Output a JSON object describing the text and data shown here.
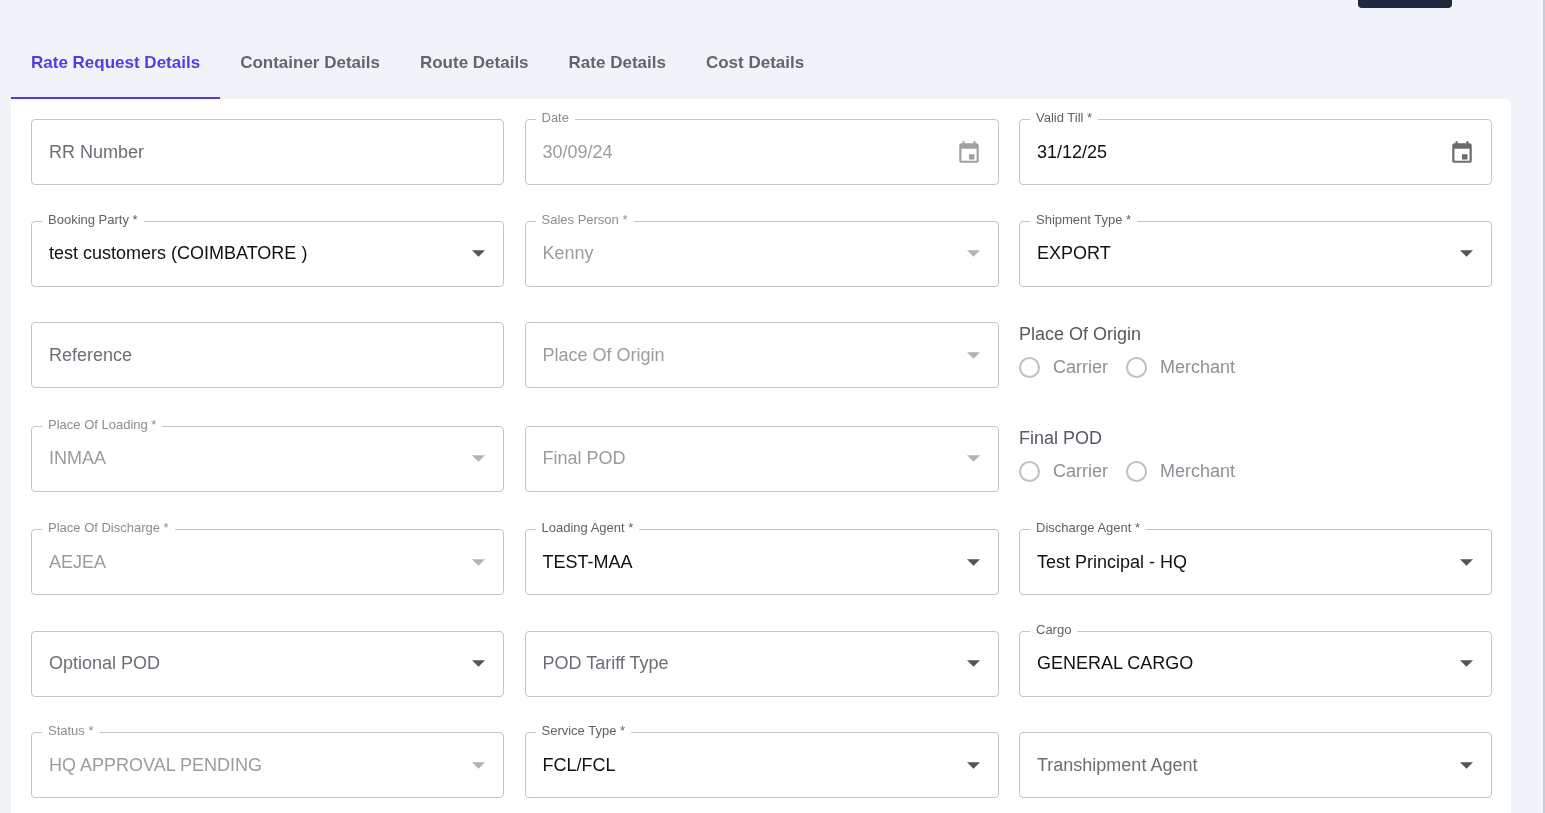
{
  "tabs": [
    {
      "label": "Rate Request Details",
      "selected": true
    },
    {
      "label": "Container Details",
      "selected": false
    },
    {
      "label": "Route Details",
      "selected": false
    },
    {
      "label": "Rate Details",
      "selected": false
    },
    {
      "label": "Cost Details",
      "selected": false
    }
  ],
  "fields": [
    {
      "kind": "text",
      "placeholder": "RR Number",
      "disabled": false
    },
    {
      "kind": "date",
      "label": "Date",
      "value": "30/09/24",
      "disabled": true
    },
    {
      "kind": "date",
      "label": "Valid Till *",
      "value": "31/12/25",
      "disabled": false
    },
    {
      "kind": "select",
      "label": "Booking Party *",
      "value": "test customers (COIMBATORE )",
      "disabled": false
    },
    {
      "kind": "select",
      "label": "Sales Person *",
      "value": "Kenny",
      "disabled": true
    },
    {
      "kind": "select",
      "label": "Shipment Type *",
      "value": "EXPORT",
      "disabled": false
    },
    {
      "kind": "text",
      "placeholder": "Reference",
      "disabled": false
    },
    {
      "kind": "select",
      "placeholder": "Place Of Origin",
      "disabled": true
    },
    {
      "kind": "radio",
      "label": "Place Of Origin",
      "options": [
        {
          "label": "Carrier",
          "selected": false
        },
        {
          "label": "Merchant",
          "selected": false
        }
      ]
    },
    {
      "kind": "select",
      "label": "Place Of Loading *",
      "value": "INMAA",
      "disabled": true
    },
    {
      "kind": "select",
      "placeholder": "Final POD",
      "disabled": true
    },
    {
      "kind": "radio",
      "label": "Final POD",
      "options": [
        {
          "label": "Carrier",
          "selected": false
        },
        {
          "label": "Merchant",
          "selected": false
        }
      ]
    },
    {
      "kind": "select",
      "label": "Place Of Discharge *",
      "value": "AEJEA",
      "disabled": true
    },
    {
      "kind": "select",
      "label": "Loading Agent *",
      "value": "TEST-MAA",
      "disabled": false
    },
    {
      "kind": "select",
      "label": "Discharge Agent *",
      "value": "Test Principal - HQ",
      "disabled": false
    },
    {
      "kind": "select",
      "placeholder": "Optional POD",
      "disabled": false
    },
    {
      "kind": "select",
      "placeholder": "POD Tariff Type",
      "disabled": false
    },
    {
      "kind": "select",
      "label": "Cargo",
      "value": "GENERAL CARGO",
      "disabled": false
    },
    {
      "kind": "select",
      "label": "Status *",
      "value": "HQ APPROVAL PENDING",
      "disabled": true
    },
    {
      "kind": "select",
      "label": "Service Type *",
      "value": "FCL/FCL",
      "disabled": false
    },
    {
      "kind": "select",
      "placeholder": "Transhipment Agent",
      "disabled": false
    }
  ]
}
